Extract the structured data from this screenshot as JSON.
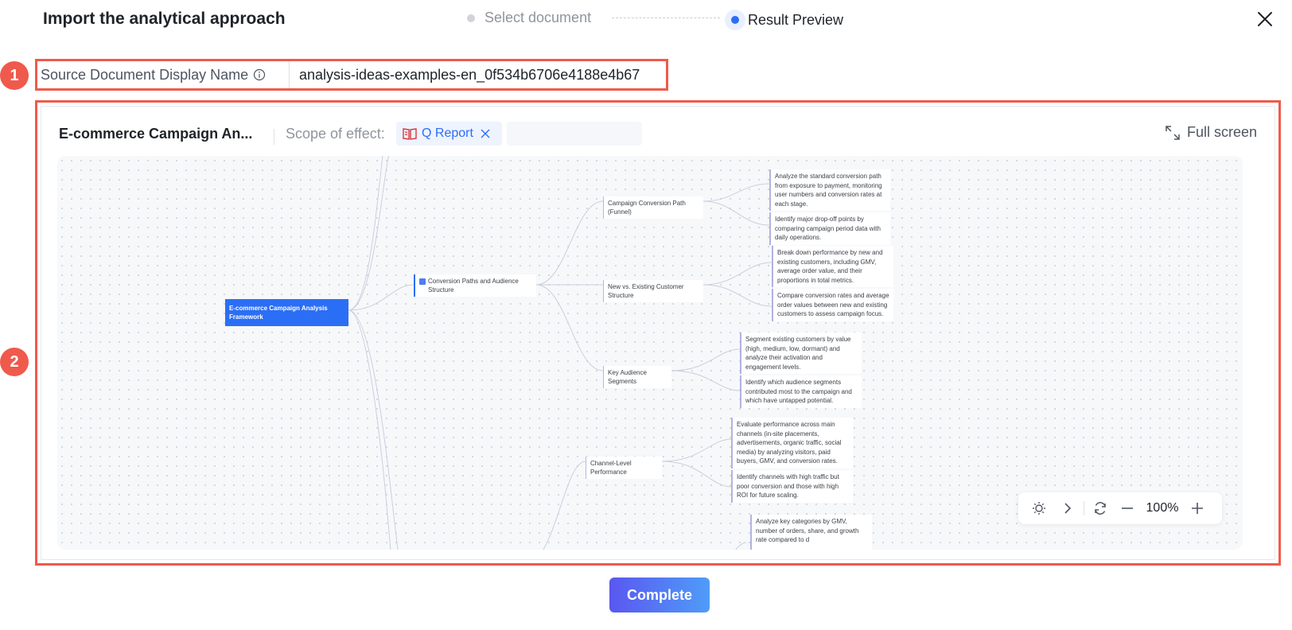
{
  "dialog": {
    "title": "Import the analytical approach"
  },
  "steps": [
    {
      "label": "Select document",
      "state": "done"
    },
    {
      "label": "Result Preview",
      "state": "active"
    }
  ],
  "source": {
    "label": "Source Document Display Name",
    "value": "analysis-ideas-examples-en_0f534b6706e4188e4b67"
  },
  "callouts": [
    "1",
    "2"
  ],
  "preview": {
    "title": "E-commerce Campaign An...",
    "scope_label": "Scope of effect:",
    "scope_tag": "Q Report",
    "fullscreen_label": "Full screen",
    "zoom": "100%"
  },
  "mindmap": {
    "root": "E-commerce Campaign Analysis Framework",
    "branch": "Conversion Paths and Audience Structure",
    "topics": [
      {
        "label": "Campaign Conversion Path (Funnel)",
        "leaves": [
          "Analyze the standard conversion path from exposure to payment, monitoring user numbers and conversion rates at each stage.",
          "Identify major drop-off points by comparing campaign period data with daily operations."
        ]
      },
      {
        "label": "New vs. Existing Customer Structure",
        "leaves": [
          "Break down performance by new and existing customers, including GMV, average order value, and their proportions in total metrics.",
          "Compare conversion rates and average order values between new and existing customers to assess campaign focus."
        ]
      },
      {
        "label": "Key Audience Segments",
        "leaves": [
          "Segment existing customers by value (high, medium, low, dormant) and analyze their activation and engagement levels.",
          "Identify which audience segments contributed most to the campaign and which have untapped potential."
        ]
      },
      {
        "label": "Channel-Level Performance",
        "leaves": [
          "Evaluate performance across main channels (in-site placements, advertisements, organic traffic, social media) by analyzing visitors, paid buyers, GMV, and conversion rates.",
          "Identify channels with high traffic but poor conversion and those with high ROI for future scaling.",
          "Analyze key categories by GMV, number of orders, share, and growth rate compared to d"
        ]
      }
    ]
  },
  "footer": {
    "complete_label": "Complete"
  },
  "colors": {
    "accent": "#2b6ef6",
    "callout": "#ef5a4c"
  }
}
